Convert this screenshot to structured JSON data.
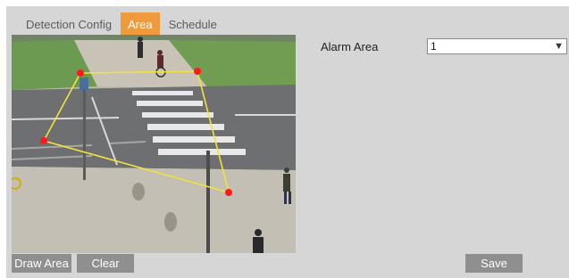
{
  "tabs": [
    {
      "label": "Detection Config",
      "active": false
    },
    {
      "label": "Area",
      "active": true
    },
    {
      "label": "Schedule",
      "active": false
    }
  ],
  "alarm_area": {
    "label": "Alarm Area",
    "selected": "1"
  },
  "buttons": {
    "draw_area": "Draw Area",
    "clear": "Clear",
    "save": "Save"
  },
  "colors": {
    "accent": "#f09a3e",
    "button": "#8f8f8f",
    "panel": "#d6d6d6",
    "area_line": "#f2e33a",
    "area_point": "#ff1a1a"
  },
  "icons": {
    "dropdown": "chevron-down-icon"
  }
}
